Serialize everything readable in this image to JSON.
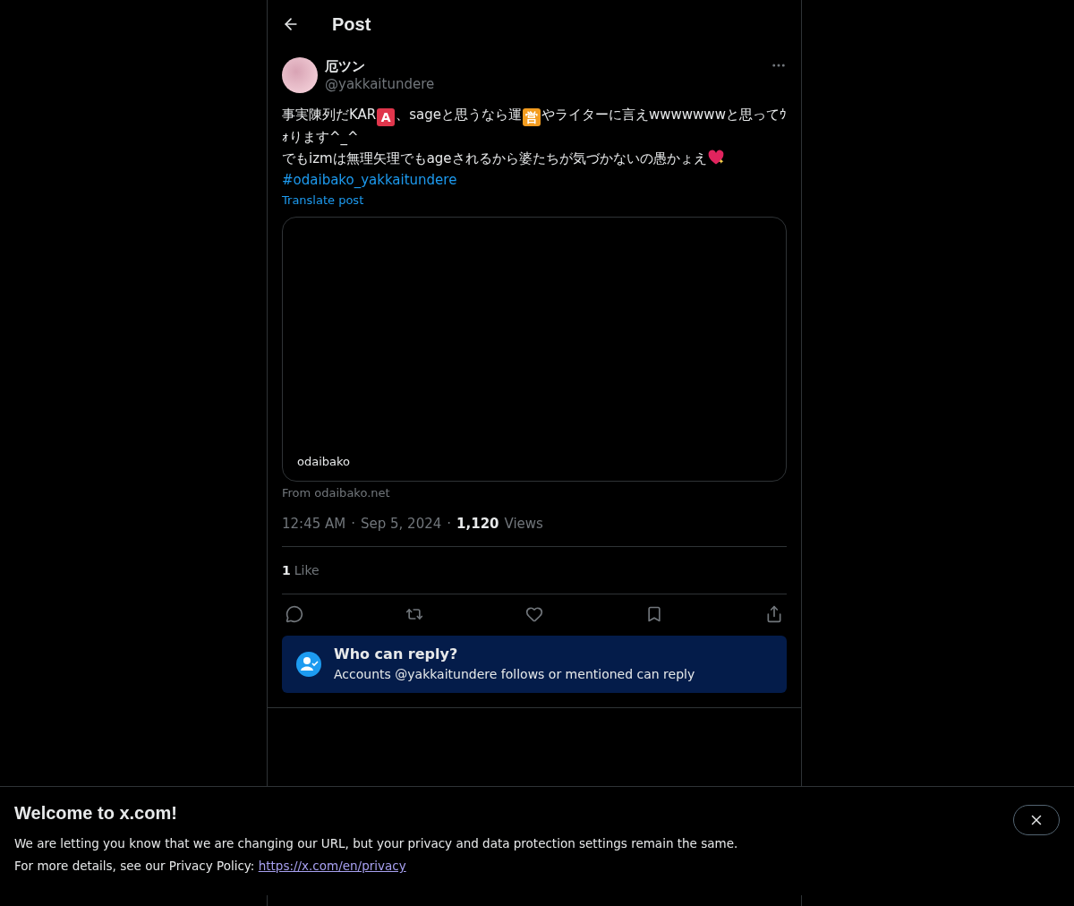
{
  "header": {
    "title": "Post"
  },
  "author": {
    "name": "厄ツン",
    "handle": "@yakkaitundere"
  },
  "body": [
    {
      "kind": "text",
      "text": "事実陳列だKAR"
    },
    {
      "kind": "badge",
      "text": "A",
      "color": "#e0364c"
    },
    {
      "kind": "text",
      "text": "、sageと思うなら運"
    },
    {
      "kind": "badge",
      "text": "営",
      "color": "#f39c1f"
    },
    {
      "kind": "text",
      "text": "やライターに言えwwwwwwwと思ってｳｫります^_^"
    },
    {
      "kind": "break"
    },
    {
      "kind": "text",
      "text": "でもizmは無理矢理でもageされるから婆たちが気づかないの愚かょえ"
    },
    {
      "kind": "heart"
    },
    {
      "kind": "break"
    },
    {
      "kind": "link",
      "text": "#odaibako_yakkaitundere"
    }
  ],
  "translate": "Translate post",
  "card": {
    "label": "odaibako",
    "source": "From odaibako.net"
  },
  "meta": {
    "time": "12:45 AM",
    "separator": "·",
    "date": "Sep 5, 2024",
    "views_count": "1,120",
    "views_label": "Views"
  },
  "likes": {
    "count": "1",
    "label": "Like"
  },
  "actions": [
    {
      "kind": "reply"
    },
    {
      "kind": "repost"
    },
    {
      "kind": "like"
    },
    {
      "kind": "bookmark"
    },
    {
      "kind": "share"
    }
  ],
  "reply_notice": {
    "title": "Who can reply?",
    "text": "Accounts @yakkaitundere follows or mentioned can reply"
  },
  "banner": {
    "title": "Welcome to x.com!",
    "line1": "We are letting you know that we are changing our URL, but your privacy and data protection settings remain the same.",
    "line2": "For more details, see our Privacy Policy: ",
    "link": "https://x.com/en/privacy"
  }
}
